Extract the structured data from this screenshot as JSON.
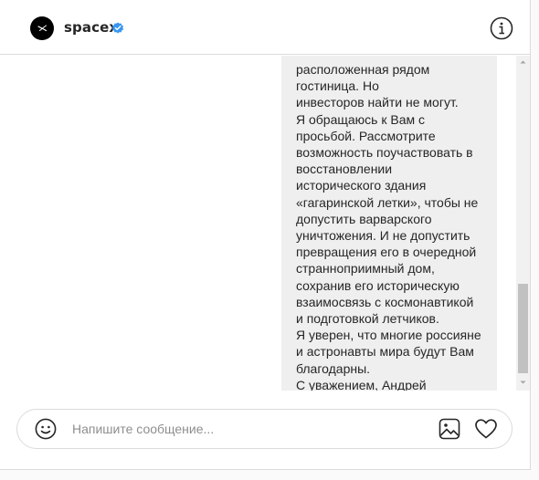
{
  "header": {
    "username": "spacex",
    "verified": true,
    "avatar_icon": "spacex-logo-icon",
    "info_icon": "info-icon"
  },
  "message": {
    "text": "расположенная рядом гостиница. Но\nинвесторов найти не могут.\nЯ обращаюсь к Вам с\nпросьбой. Рассмотрите\nвозможность поучаствовать в\nвосстановлении\nисторического здания\n«гагаринской летки», чтобы не\nдопустить варварского\nуничтожения. И не допустить\nпревращения его в очередной\nстраннoприимный дом,\nсохранив его историческую\nвзаимосвязь с космонавтикой\nи подготовкой летчиков.\nЯ уверен, что многие россияне\nи астронавты мира будут Вам\nблагодарны.\nС уважением, Андрей\nЛысенко.",
    "bubble_color": "#efefef"
  },
  "composer": {
    "placeholder": "Напишите сообщение...",
    "value": "",
    "emoji_icon": "smiley-icon",
    "image_icon": "image-icon",
    "like_icon": "heart-icon"
  },
  "colors": {
    "verified_badge": "#3897f0",
    "border": "#dbdbdb",
    "text": "#262626",
    "placeholder": "#8e8e8e"
  }
}
